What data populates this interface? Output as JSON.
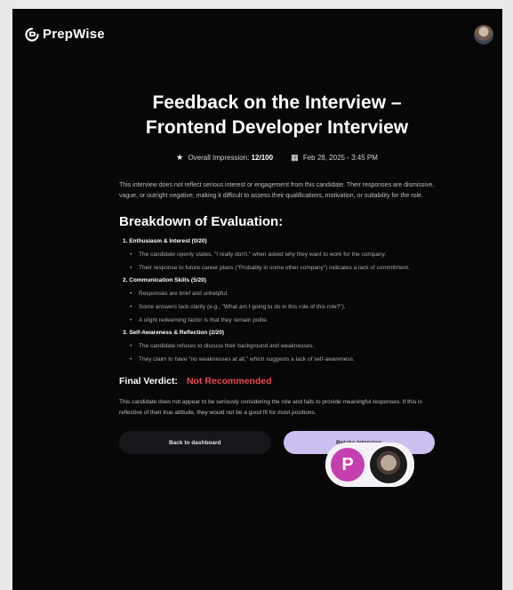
{
  "app": {
    "name": "PrepWise"
  },
  "page": {
    "title_line1": "Feedback on the Interview –",
    "title_line2": "Frontend Developer Interview"
  },
  "meta": {
    "impression_label": "Overall Impression:",
    "impression_value": "12/100",
    "date": "Feb 28, 2025 - 3:45 PM"
  },
  "intro": "This interview does not reflect serious interest or engagement from this candidate. Their responses are dismissive, vague, or outright negative, making it difficult to assess their qualifications, motivation, or suitability for the role.",
  "breakdown": {
    "heading": "Breakdown of Evaluation:",
    "categories": [
      {
        "title": "1. Enthusiasm & Interest (0/20)",
        "bullets": [
          "The candidate openly states, \"I really don't,\" when asked why they want to work for the company.",
          "Their response to future career plans (\"Probably in some other company\") indicates a lack of commitment."
        ]
      },
      {
        "title": "2. Communication Skills (5/20)",
        "bullets": [
          "Responses are brief and unhelpful.",
          "Some answers lack clarity (e.g., \"What am I going to do in this role of this role?\").",
          "A slight redeeming factor is that they remain polite."
        ]
      },
      {
        "title": "3. Self-Awareness & Reflection (2/20)",
        "bullets": [
          "The candidate refuses to discuss their background and weaknesses.",
          "They claim to have \"no weaknesses at all,\" which suggests a lack of self-awareness."
        ]
      }
    ]
  },
  "verdict": {
    "label": "Final Verdict:",
    "value": "Not Recommended",
    "color": "#e8474f"
  },
  "conclusion": "This candidate does not appear to be seriously considering the role and fails to provide meaningful responses. If this is reflective of their true attitude, they would not be a good fit for most positions.",
  "actions": {
    "back": "Back to dashboard",
    "retake": "Retake Interview"
  },
  "call": {
    "user_initial": "P",
    "user_color": "#c53fb0"
  },
  "colors": {
    "background": "#070708",
    "accent": "#cdbff0"
  }
}
